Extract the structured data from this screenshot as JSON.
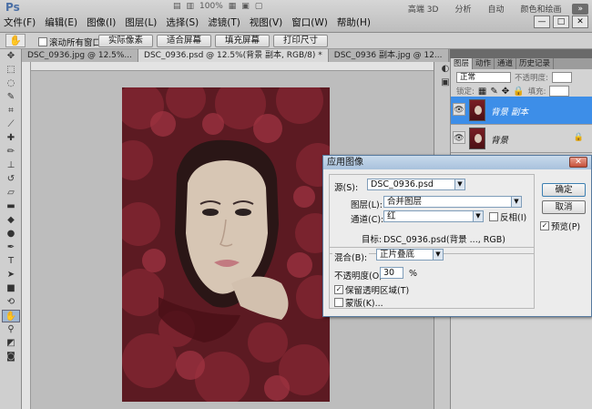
{
  "app": {
    "logo": "Ps",
    "menu": [
      "文件(F)",
      "编辑(E)",
      "图像(I)",
      "图层(L)",
      "选择(S)",
      "滤镜(T)",
      "视图(V)",
      "窗口(W)",
      "帮助(H)"
    ],
    "zoom": "100%",
    "workspaces": [
      "高端 3D",
      "分析",
      "自动",
      "颜色和绘画"
    ],
    "window_buttons": [
      "—",
      "□",
      "✕"
    ]
  },
  "options": {
    "tool_icon": "hand-icon",
    "scroll_all_label": "滚动所有窗口",
    "buttons": [
      "实际像素",
      "适合屏幕",
      "填充屏幕",
      "打印尺寸"
    ]
  },
  "tabs": [
    "DSC_0936.jpg @ 12.5%...",
    "DSC_0936.psd @ 12.5%(背景 副本, RGB/8) *",
    "DSC_0936 副本.jpg @ 12..."
  ],
  "layers_panel": {
    "tabs": [
      "图层",
      "动作",
      "通道",
      "历史记录"
    ],
    "blend_mode": "正常",
    "opacity_label": "不透明度:",
    "lock_label": "锁定:",
    "fill_label": "填充:",
    "layers": [
      {
        "name": "背景 副本",
        "selected": true,
        "locked": false
      },
      {
        "name": "背景",
        "selected": false,
        "locked": true
      }
    ]
  },
  "dialog": {
    "title": "应用图像",
    "source_label": "源(S):",
    "source_value": "DSC_0936.psd",
    "layer_label": "图层(L):",
    "layer_value": "合并图层",
    "channel_label": "通道(C):",
    "channel_value": "红",
    "invert_label": "反相(I)",
    "target_label": "目标:",
    "target_value": "DSC_0936.psd(背景 ..., RGB)",
    "blend_label": "混合(B):",
    "blend_value": "正片叠底",
    "opacity_label": "不透明度(O):",
    "opacity_value": "30",
    "opacity_unit": "%",
    "preserve_label": "保留透明区域(T)",
    "preserve_checked": true,
    "mask_label": "蒙版(K)...",
    "mask_checked": false,
    "ok_label": "确定",
    "cancel_label": "取消",
    "preview_label": "预览(P)",
    "preview_checked": true
  }
}
